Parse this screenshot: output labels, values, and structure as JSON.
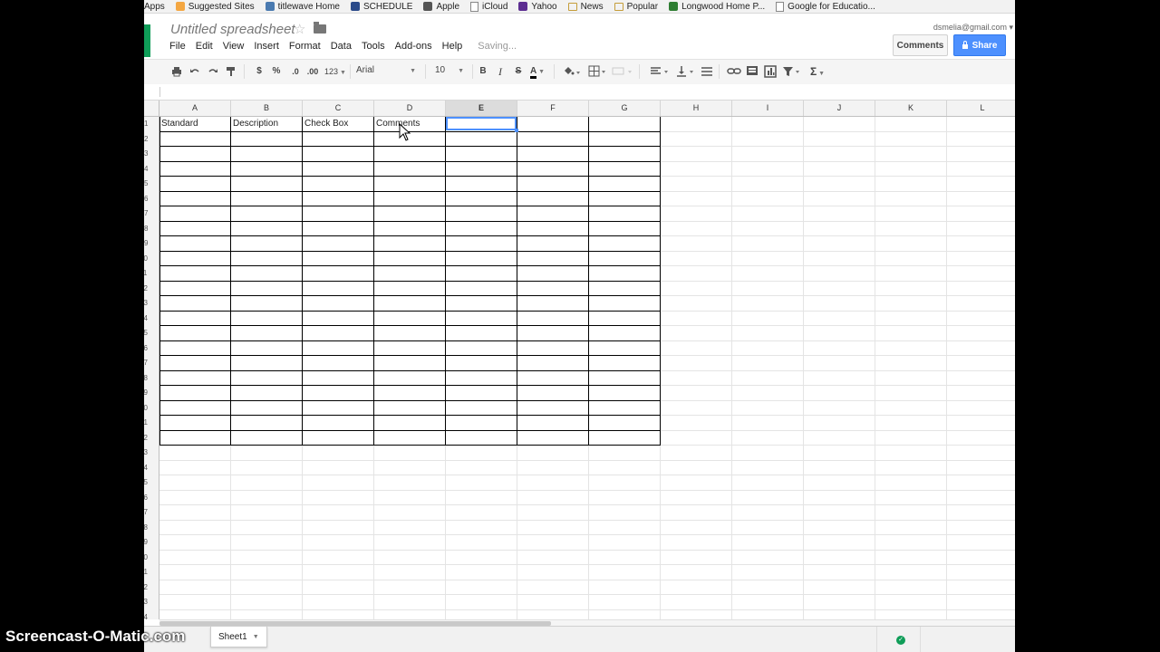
{
  "bookmarks": [
    {
      "label": "Apps",
      "icon": "apps-icon",
      "color": "#777777"
    },
    {
      "label": "Suggested Sites",
      "icon": "suggested-sites-icon",
      "color": "#f4a742"
    },
    {
      "label": "titlewave Home",
      "icon": "titlewave-icon",
      "color": "#4a7ab0"
    },
    {
      "label": "SCHEDULE",
      "icon": "schedule-icon",
      "color": "#2a4a8a"
    },
    {
      "label": "Apple",
      "icon": "apple-icon",
      "color": "#555555"
    },
    {
      "label": "iCloud",
      "icon": "page-icon",
      "color": "#888888"
    },
    {
      "label": "Yahoo",
      "icon": "yahoo-icon",
      "color": "#5c2d91"
    },
    {
      "label": "News",
      "icon": "folder-icon",
      "color": "#c59d3a"
    },
    {
      "label": "Popular",
      "icon": "folder-icon",
      "color": "#c59d3a"
    },
    {
      "label": "Longwood Home P...",
      "icon": "longwood-icon",
      "color": "#2e7d32"
    },
    {
      "label": "Google for Educatio...",
      "icon": "page-icon",
      "color": "#888888"
    }
  ],
  "header": {
    "title": "Untitled spreadsheet",
    "star": "☆",
    "user": "dsmelia@gmail.com ▾",
    "comments_label": "Comments",
    "share_label": "Share",
    "saving": "Saving..."
  },
  "menu": [
    "File",
    "Edit",
    "View",
    "Insert",
    "Format",
    "Data",
    "Tools",
    "Add-ons",
    "Help"
  ],
  "toolbar": {
    "currency": "$",
    "percent": "%",
    "dec_decrease": ".0",
    "dec_increase": ".00",
    "format_more": "123",
    "font": "Arial",
    "font_size": "10",
    "bold": "B",
    "italic": "I",
    "strike": "S",
    "text_color": "A",
    "sum": "Σ"
  },
  "formula_bar": {
    "value": ""
  },
  "columns": [
    "A",
    "B",
    "C",
    "D",
    "E",
    "F",
    "G",
    "H",
    "I",
    "J",
    "K",
    "L"
  ],
  "selected_column": "E",
  "rows": [
    "1",
    "2",
    "3",
    "4",
    "5",
    "6",
    "7",
    "8",
    "9",
    "10",
    "11",
    "12",
    "13",
    "14",
    "15",
    "16",
    "17",
    "18",
    "19",
    "20",
    "21",
    "22",
    "23",
    "24",
    "25",
    "26",
    "27",
    "28",
    "29",
    "30",
    "31",
    "32",
    "33",
    "34"
  ],
  "cells": {
    "A1": "Standard",
    "B1": "Description",
    "C1": "Check Box",
    "D1": "Comments"
  },
  "sheet_tab": {
    "label": "Sheet1"
  },
  "watermark": "Screencast-O-Matic.com",
  "colors": {
    "accent": "#4d90fe",
    "brand": "#0f9d58",
    "border_table": "#000000"
  }
}
